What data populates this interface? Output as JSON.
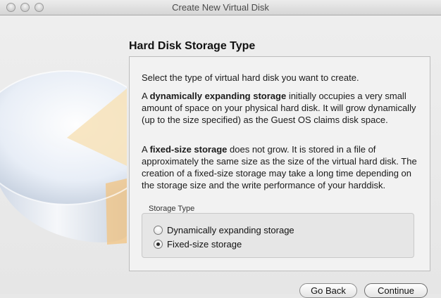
{
  "window": {
    "title": "Create New Virtual Disk"
  },
  "page": {
    "heading": "Hard Disk Storage Type",
    "intro": "Select the type of virtual hard disk you want to create.",
    "dynamic_para": {
      "prefix": "A ",
      "bold": "dynamically expanding storage",
      "rest": " initially occupies a very small amount of space on your physical hard disk. It will grow dynamically (up to the size specified) as the Guest OS claims disk space."
    },
    "fixed_para": {
      "prefix": "A ",
      "bold": "fixed-size storage",
      "rest": " does not grow. It is stored in a file of approximately the same size as the size of the virtual hard disk. The creation of a fixed-size storage may take a long time depending on the storage size and the write performance of your harddisk."
    }
  },
  "storage_type": {
    "label": "Storage Type",
    "options": [
      {
        "label": "Dynamically expanding storage",
        "selected": false
      },
      {
        "label": "Fixed-size storage",
        "selected": true
      }
    ]
  },
  "buttons": {
    "back": "Go Back",
    "continue": "Continue"
  },
  "icons": {
    "disk": "hard-disk-icon"
  },
  "colors": {
    "disk_accent": "#f3c27a"
  }
}
